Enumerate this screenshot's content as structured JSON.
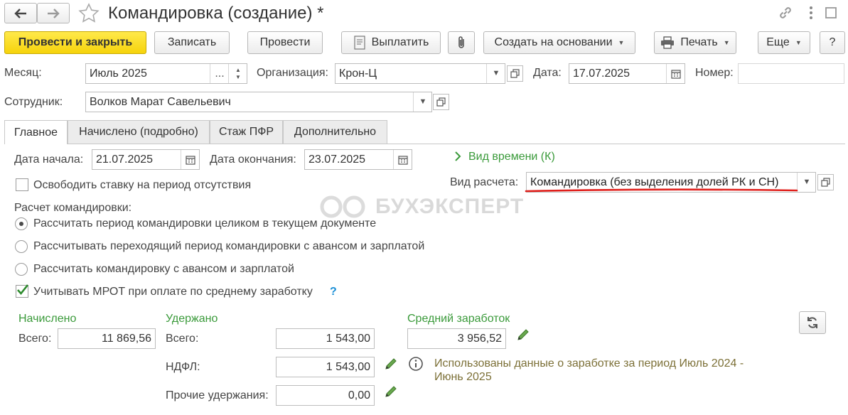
{
  "window": {
    "title": "Командировка (создание) *"
  },
  "toolbar": {
    "post_close": "Провести и закрыть",
    "save": "Записать",
    "post": "Провести",
    "pay": "Выплатить",
    "create_based": "Создать на основании",
    "print": "Печать",
    "more": "Еще",
    "help": "?"
  },
  "header": {
    "month_label": "Месяц:",
    "month_value": "Июль 2025",
    "month_dots": "...",
    "org_label": "Организация:",
    "org_value": "Крон-Ц",
    "date_label": "Дата:",
    "date_value": "17.07.2025",
    "number_label": "Номер:",
    "number_value": "",
    "employee_label": "Сотрудник:",
    "employee_value": "Волков Марат Савельевич"
  },
  "tabs": [
    {
      "label": "Главное"
    },
    {
      "label": "Начислено (подробно)"
    },
    {
      "label": "Стаж ПФР"
    },
    {
      "label": "Дополнительно"
    }
  ],
  "main": {
    "start_label": "Дата начала:",
    "start_value": "21.07.2025",
    "end_label": "Дата окончания:",
    "end_value": "23.07.2025",
    "time_type_link": "Вид времени (К)",
    "free_rate_label": "Освободить ставку на период отсутствия",
    "calc_type_label": "Вид расчета:",
    "calc_type_value": "Командировка (без выделения долей РК и СН)",
    "trip_calc_title": "Расчет командировки:",
    "options": [
      {
        "label": "Рассчитать период командировки целиком в текущем документе",
        "selected": true
      },
      {
        "label": "Рассчитывать переходящий период командировки с авансом и зарплатой",
        "selected": false
      },
      {
        "label": "Рассчитать командировку с авансом и зарплатой",
        "selected": false
      }
    ],
    "mrot_label": "Учитывать МРОТ при оплате по среднему заработку",
    "mrot_checked": true,
    "help_mark": "?"
  },
  "watermark": "БУХЭКСПЕРТ",
  "totals": {
    "accrued_title": "Начислено",
    "accrued_total_label": "Всего:",
    "accrued_total": "11 869,56",
    "withheld_title": "Удержано",
    "withheld_total_label": "Всего:",
    "withheld_total": "1 543,00",
    "ndfl_label": "НДФЛ:",
    "ndfl_value": "1 543,00",
    "other_label": "Прочие удержания:",
    "other_value": "0,00",
    "avg_title": "Средний заработок",
    "avg_value": "3 956,52",
    "info_text": "Использованы данные о заработке за период Июль 2024 - Июнь 2025"
  },
  "colors": {
    "primary_button": "#f6d30c",
    "accent_green": "#3a9a3a",
    "underline": "#e0201c",
    "info_text": "#7c7037"
  }
}
